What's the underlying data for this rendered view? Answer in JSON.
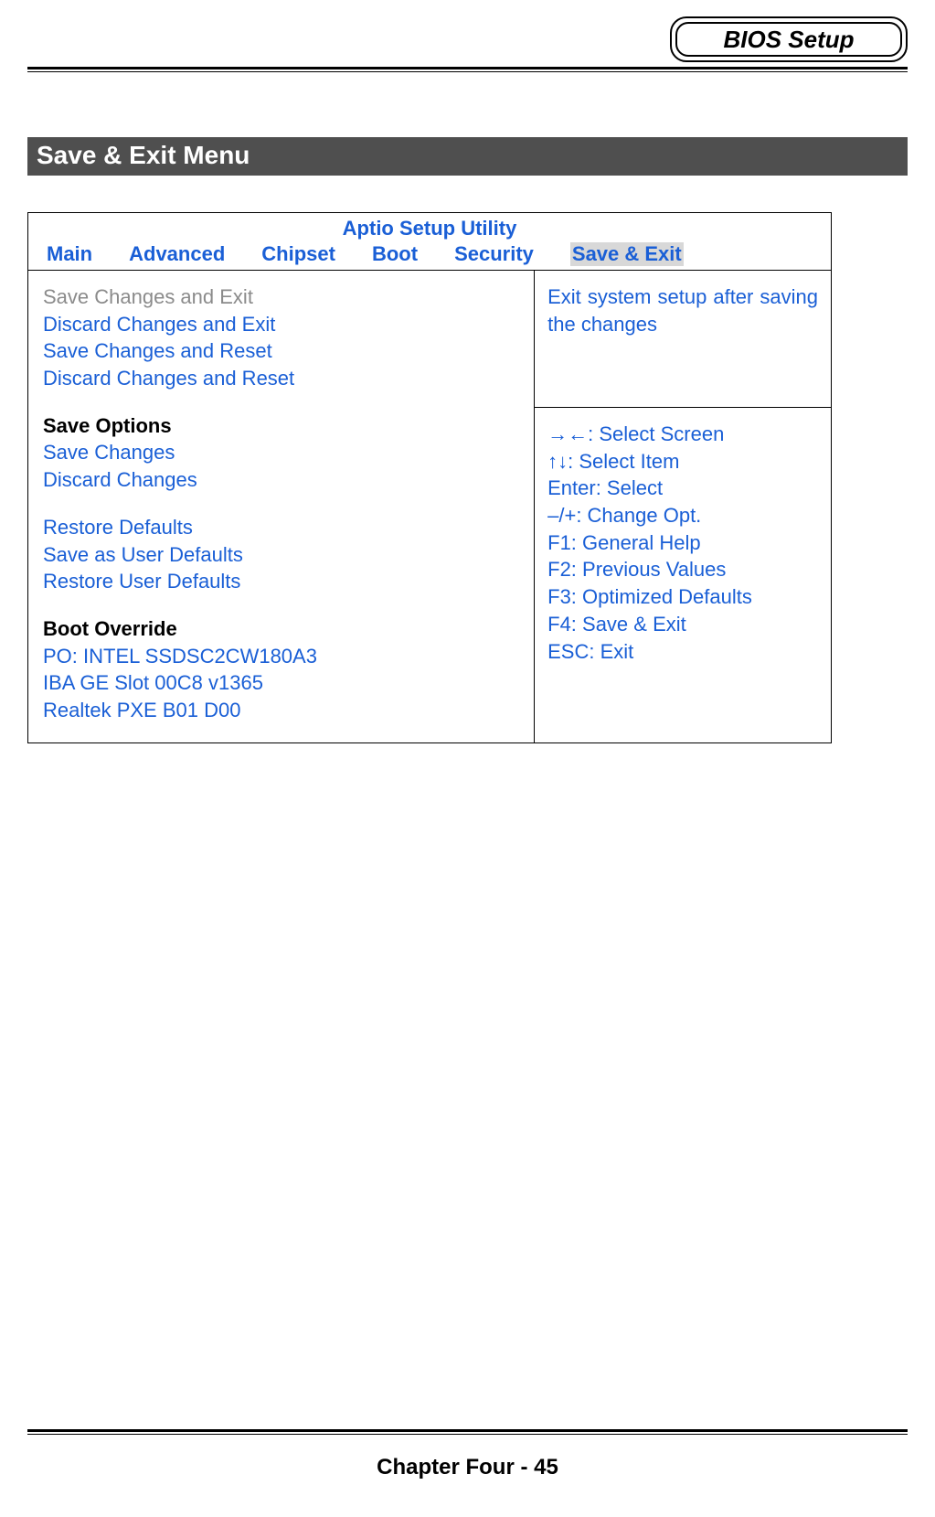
{
  "header": {
    "badge": "BIOS Setup"
  },
  "section": {
    "title": "Save & Exit Menu"
  },
  "bios": {
    "utility_title": "Aptio Setup Utility",
    "tabs": {
      "main": "Main",
      "advanced": "Advanced",
      "chipset": "Chipset",
      "boot": "Boot",
      "security": "Security",
      "save_exit": "Save & Exit"
    },
    "left": {
      "save_changes_exit": "Save Changes and Exit",
      "discard_changes_exit": "Discard Changes and Exit",
      "save_changes_reset": "Save Changes and Reset",
      "discard_changes_reset": "Discard Changes and Reset",
      "save_options_hdr": "Save Options",
      "save_changes": "Save Changes",
      "discard_changes": "Discard Changes",
      "restore_defaults": "Restore Defaults",
      "save_user_defaults": "Save as User Defaults",
      "restore_user_defaults": "Restore User Defaults",
      "boot_override_hdr": "Boot Override",
      "boot1": "PO: INTEL SSDSC2CW180A3",
      "boot2": "IBA GE Slot 00C8 v1365",
      "boot3": "Realtek PXE B01 D00"
    },
    "help_text": "Exit system setup after saving the changes",
    "keys": {
      "k1": "→←: Select Screen",
      "k2": "↑↓: Select Item",
      "k3": "Enter: Select",
      "k4": "–/+: Change Opt.",
      "k5": "F1: General Help",
      "k6": "F2: Previous Values",
      "k7": "F3: Optimized Defaults",
      "k8": "F4: Save & Exit",
      "k9": "ESC: Exit"
    }
  },
  "footer": {
    "text": "Chapter Four - 45"
  }
}
